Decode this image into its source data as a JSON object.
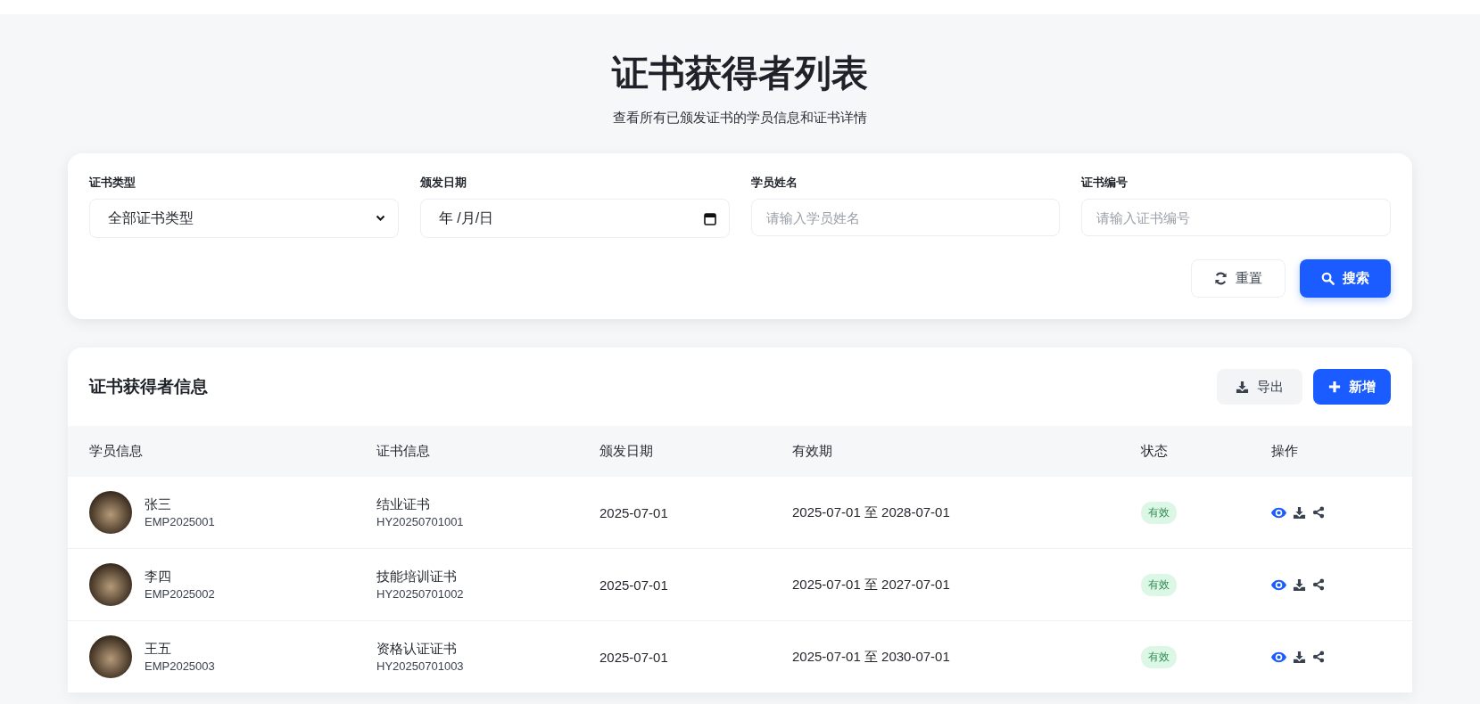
{
  "header": {
    "title": "证书获得者列表",
    "subtitle": "查看所有已颁发证书的学员信息和证书详情"
  },
  "filters": [
    {
      "kind": "select",
      "label": "证书类型",
      "value": "全部证书类型"
    },
    {
      "kind": "date",
      "label": "颁发日期",
      "value": "年 /月/日"
    },
    {
      "kind": "text",
      "label": "学员姓名",
      "placeholder": "请输入学员姓名"
    },
    {
      "kind": "text",
      "label": "证书编号",
      "placeholder": "请输入证书编号"
    }
  ],
  "filter_buttons": [
    {
      "kind": "reset",
      "label": "重置"
    },
    {
      "kind": "search",
      "label": "搜索"
    }
  ],
  "table": {
    "title": "证书获得者信息",
    "actions": [
      {
        "kind": "export",
        "label": "导出"
      },
      {
        "kind": "add",
        "label": "新增"
      }
    ],
    "columns": [
      "学员信息",
      "证书信息",
      "颁发日期",
      "有效期",
      "状态",
      "操作"
    ],
    "rows": [
      {
        "name": "张三",
        "employee_id": "EMP2025001",
        "certificate": "结业证书",
        "certificate_no": "HY20250701001",
        "issue_date": "2025-07-01",
        "validity": "2025-07-01 至 2028-07-01",
        "status": "有效"
      },
      {
        "name": "李四",
        "employee_id": "EMP2025002",
        "certificate": "技能培训证书",
        "certificate_no": "HY20250701002",
        "issue_date": "2025-07-01",
        "validity": "2025-07-01 至 2027-07-01",
        "status": "有效"
      },
      {
        "name": "王五",
        "employee_id": "EMP2025003",
        "certificate": "资格认证证书",
        "certificate_no": "HY20250701003",
        "issue_date": "2025-07-01",
        "validity": "2025-07-01 至 2030-07-01",
        "status": "有效"
      }
    ]
  }
}
